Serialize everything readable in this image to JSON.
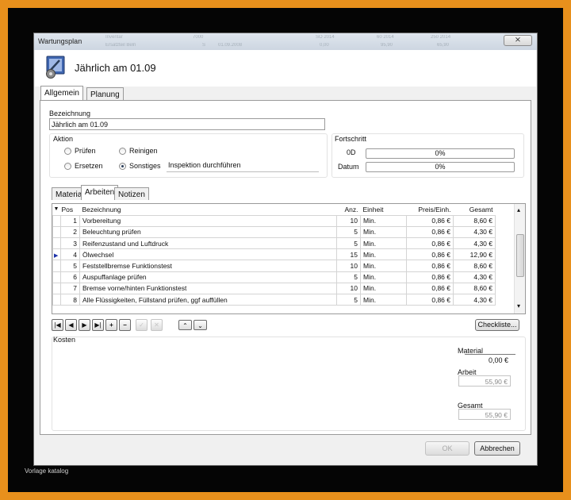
{
  "window": {
    "title": "Wartungsplan",
    "close_glyph": "⨯"
  },
  "background_ghost": [
    "Inventar",
    "7000",
    "SO 2014",
    "60 2014",
    "250 2014",
    "Ersatzteil Beln",
    "S",
    "01.09.2008",
    "0,00",
    "95,90",
    "65,90"
  ],
  "header": {
    "title": "Jährlich am 01.09"
  },
  "tabs": [
    {
      "label": "Allgemein",
      "active": true
    },
    {
      "label": "Planung",
      "active": false
    }
  ],
  "bezeichnung": {
    "label": "Bezeichnung",
    "value": "Jährlich am 01.09"
  },
  "aktion": {
    "label": "Aktion",
    "options": [
      {
        "label": "Prüfen",
        "selected": false
      },
      {
        "label": "Reinigen",
        "selected": false
      },
      {
        "label": "Ersetzen",
        "selected": false
      },
      {
        "label": "Sonstiges",
        "selected": true
      }
    ],
    "sonstiges_text": "Inspektion durchführen"
  },
  "fortschritt": {
    "label": "Fortschritt",
    "rows": [
      {
        "label": "0D",
        "value": "0%"
      },
      {
        "label": "Datum",
        "value": "0%"
      }
    ]
  },
  "subtabs": [
    {
      "label": "Material",
      "active": false
    },
    {
      "label": "Arbeiten",
      "active": true
    },
    {
      "label": "Notizen",
      "active": false
    }
  ],
  "grid": {
    "sort_glyph": "▼",
    "columns": [
      "Pos",
      "Bezeichnung",
      "Anz.",
      "Einheit",
      "Preis/Einh.",
      "Gesamt"
    ],
    "rows": [
      {
        "pos": "1",
        "name": "Vorbereitung",
        "anz": "10",
        "unit": "Min.",
        "price": "0,86 €",
        "total": "8,60 €"
      },
      {
        "pos": "2",
        "name": "Beleuchtung prüfen",
        "anz": "5",
        "unit": "Min.",
        "price": "0,86 €",
        "total": "4,30 €"
      },
      {
        "pos": "3",
        "name": "Reifenzustand und Luftdruck",
        "anz": "5",
        "unit": "Min.",
        "price": "0,86 €",
        "total": "4,30 €"
      },
      {
        "pos": "4",
        "name": "Ölwechsel",
        "anz": "15",
        "unit": "Min.",
        "price": "0,86 €",
        "total": "12,90 €",
        "current": true
      },
      {
        "pos": "5",
        "name": "Feststellbremse Funktionstest",
        "anz": "10",
        "unit": "Min.",
        "price": "0,86 €",
        "total": "8,60 €"
      },
      {
        "pos": "6",
        "name": "Auspuffanlage prüfen",
        "anz": "5",
        "unit": "Min.",
        "price": "0,86 €",
        "total": "4,30 €"
      },
      {
        "pos": "7",
        "name": "Bremse vorne/hinten Funktionstest",
        "anz": "10",
        "unit": "Min.",
        "price": "0,86 €",
        "total": "8,60 €"
      },
      {
        "pos": "8",
        "name": "Alle Flüssigkeiten, Füllstand prüfen, ggf auffüllen",
        "anz": "5",
        "unit": "Min.",
        "price": "0,86 €",
        "total": "4,30 €"
      }
    ]
  },
  "navigator": {
    "first": "|◀",
    "prev": "◀",
    "next": "▶",
    "last": "▶|",
    "add": "+",
    "remove": "−",
    "edit": "✓",
    "cancel": "✕",
    "up": "⌃",
    "down": "⌄"
  },
  "checkliste_label": "Checkliste...",
  "kosten": {
    "label": "Kosten",
    "material_label": "Material",
    "material_value": "0,00 €",
    "arbeit_label": "Arbeit",
    "arbeit_value": "55,90 €",
    "gesamt_label": "Gesamt",
    "gesamt_value": "55,90 €"
  },
  "buttons": {
    "ok": "OK",
    "cancel": "Abbrechen"
  },
  "watermark": "Vorlage katalog"
}
